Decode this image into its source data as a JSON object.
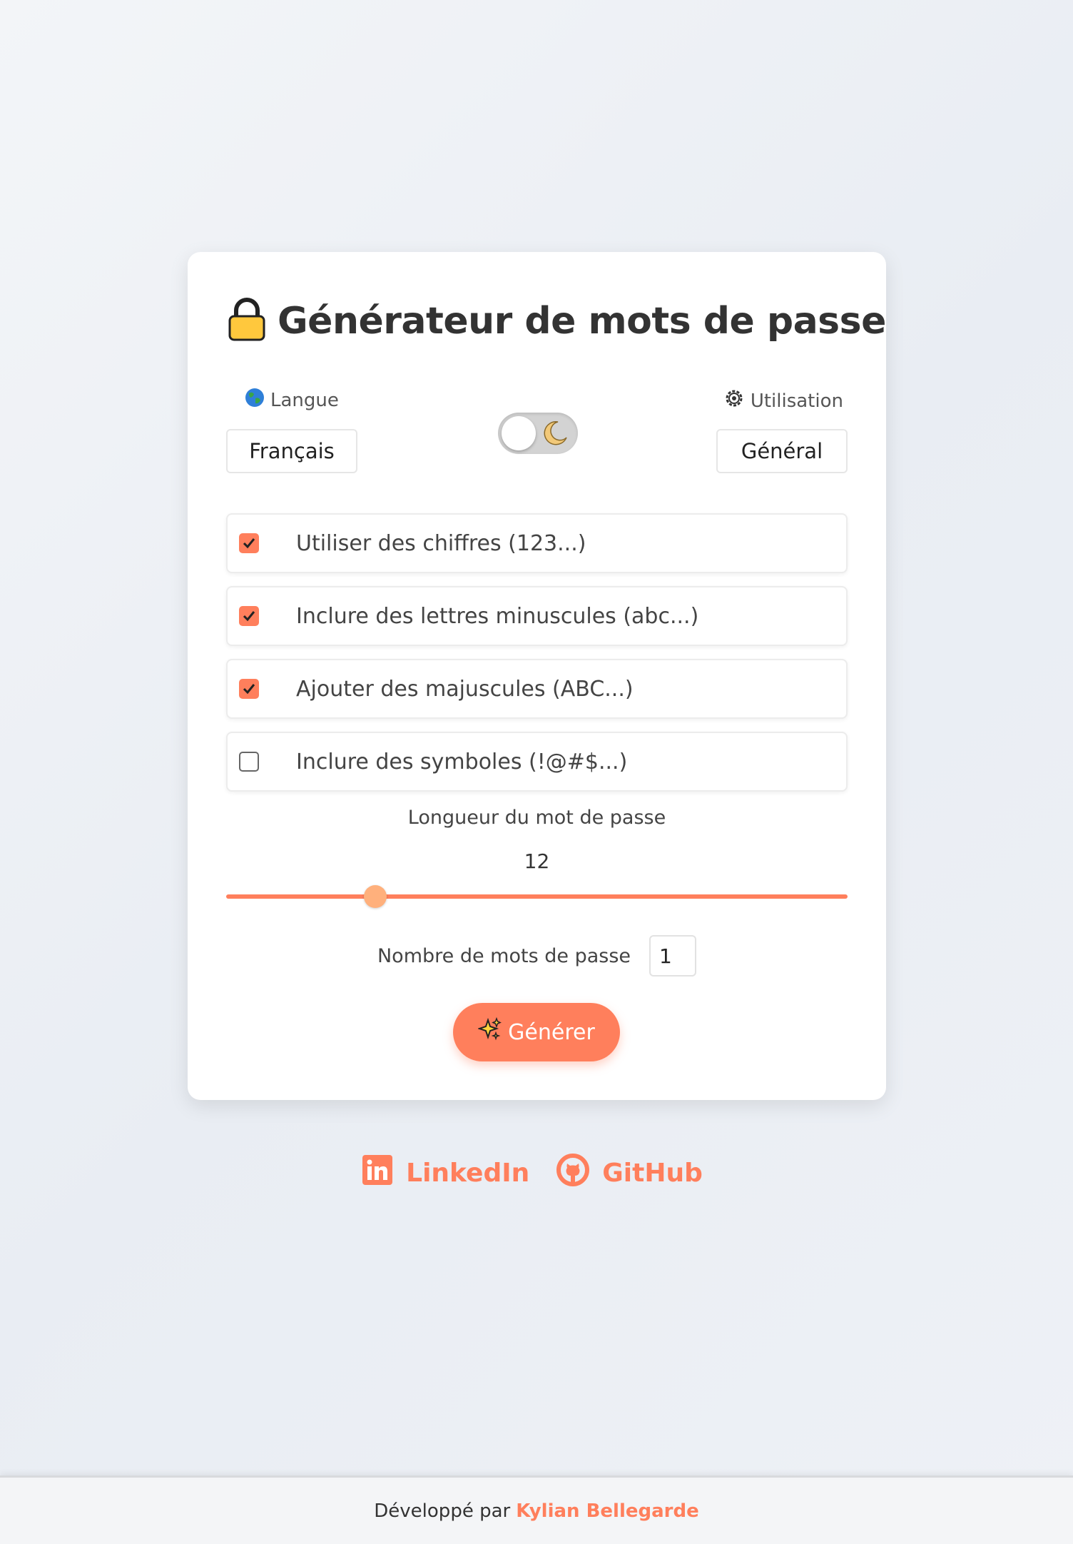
{
  "app": {
    "title": "Générateur de mots de passe",
    "accent_color": "#ff7f5c"
  },
  "language": {
    "label": "Langue",
    "icon": "globe-icon",
    "selected": "Français"
  },
  "usage": {
    "label": "Utilisation",
    "icon": "gear-icon",
    "selected": "Général"
  },
  "theme_toggle": {
    "icon": "moon-icon",
    "dark_mode": false
  },
  "options": [
    {
      "label": "Utiliser des chiffres (123...)",
      "checked": true
    },
    {
      "label": "Inclure des lettres minuscules (abc...)",
      "checked": true
    },
    {
      "label": "Ajouter des majuscules (ABC...)",
      "checked": true
    },
    {
      "label": "Inclure des symboles (!@#$...)",
      "checked": false
    }
  ],
  "length": {
    "label": "Longueur du mot de passe",
    "value": "12",
    "fraction": 0.24
  },
  "count": {
    "label": "Nombre de mots de passe",
    "value": "1"
  },
  "generate": {
    "label": "Générer",
    "icon": "sparkles-icon"
  },
  "social": {
    "linkedin": "LinkedIn",
    "github": "GitHub"
  },
  "footer": {
    "prefix": "Développé par",
    "author": "Kylian Bellegarde"
  }
}
